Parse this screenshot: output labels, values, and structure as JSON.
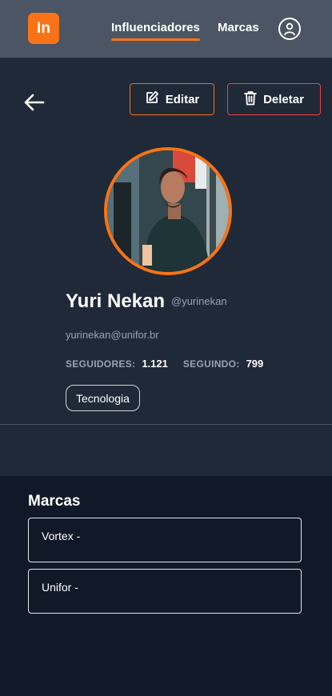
{
  "navbar": {
    "logo_text": "In",
    "links": [
      {
        "label": "Influenciadores",
        "active": true
      },
      {
        "label": "Marcas",
        "active": false
      }
    ],
    "profile_icon": "user-circle-icon"
  },
  "actions": {
    "back_icon": "arrow-left-icon",
    "edit_label": "Editar",
    "edit_icon": "pencil-square-icon",
    "delete_label": "Deletar",
    "delete_icon": "trash-icon"
  },
  "profile": {
    "name": "Yuri Nekan",
    "handle": "@yurinekan",
    "email": "yurinekan@unifor.br",
    "followers_label": "SEGUIDORES:",
    "followers": "1.121",
    "following_label": "SEGUINDO:",
    "following": "799",
    "tag": "Tecnologia"
  },
  "brands": {
    "title": "Marcas",
    "items": [
      {
        "label": "Vortex -"
      },
      {
        "label": "Unifor -"
      }
    ]
  },
  "colors": {
    "accent": "#f97316",
    "danger": "#ef4444",
    "navbar": "#4b5563",
    "hero_bg": "#1f2937",
    "page_bg": "#111827"
  }
}
